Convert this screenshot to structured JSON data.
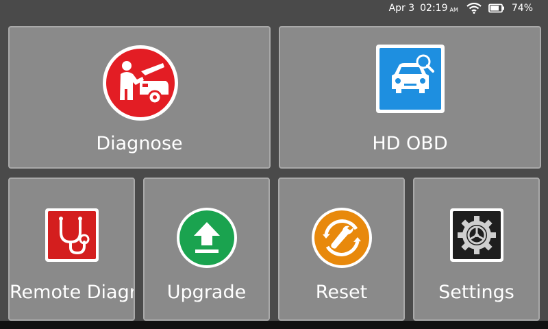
{
  "status_bar": {
    "date": "Apr 3",
    "time": "02:19",
    "ampm": "AM",
    "wifi_icon": "wifi-icon",
    "battery_icon": "battery-icon",
    "battery_percent": "74%"
  },
  "tiles": {
    "diagnose": {
      "label": "Diagnose",
      "icon": "mechanic-car-icon",
      "color": "#e31d24"
    },
    "hd_obd": {
      "label": "HD OBD",
      "icon": "car-search-icon",
      "color": "#1e8fe0"
    },
    "remote": {
      "label": "Remote Diagnose",
      "icon": "stethoscope-icon",
      "color": "#d41e1e"
    },
    "upgrade": {
      "label": "Upgrade",
      "icon": "upload-arrow-icon",
      "color": "#1aa34f"
    },
    "reset": {
      "label": "Reset",
      "icon": "wrench-reset-icon",
      "color": "#e8890c"
    },
    "settings": {
      "label": "Settings",
      "icon": "gear-icon",
      "color": "#1e1e1e"
    }
  }
}
